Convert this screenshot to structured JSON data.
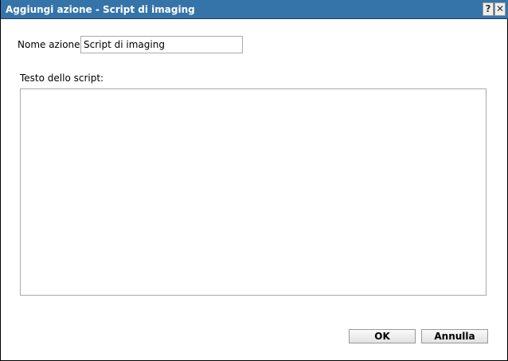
{
  "title": "Aggiungi azione - Script di imaging",
  "help": "?",
  "close": "✕",
  "name_label": "Nome azione",
  "name_value": "Script di imaging",
  "script_label": "Testo dello script:",
  "script_value": "",
  "ok": "OK",
  "cancel": "Annulla"
}
